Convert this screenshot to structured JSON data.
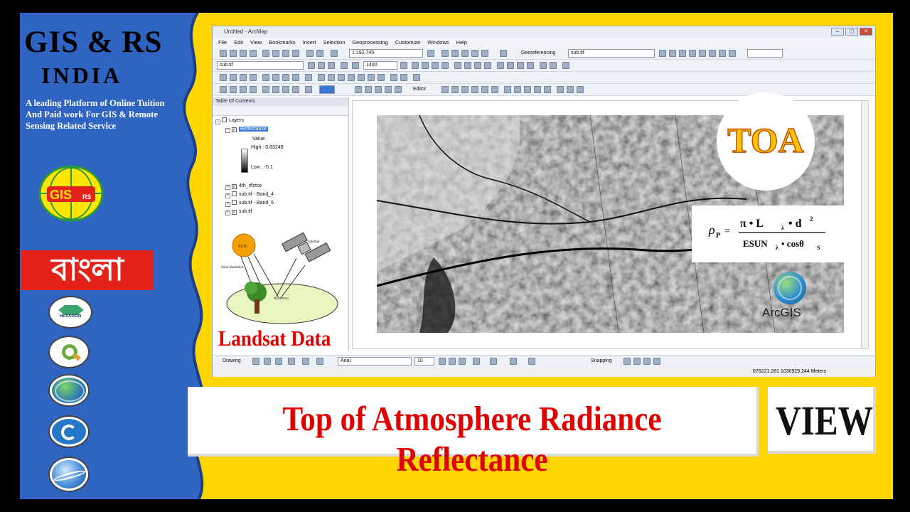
{
  "brand": {
    "title": "GIS & RS",
    "subtitle": "INDIA",
    "tagline": "A leading Platform of Online Tuition And Paid work For GIS & Remote Sensing Related Service",
    "logo_text": "GIS",
    "bangla": "বাংলা",
    "hexagon_label": "HEXAGON"
  },
  "arcmap": {
    "window_title": "Untitled - ArcMap",
    "menu": [
      "File",
      "Edit",
      "View",
      "Bookmarks",
      "Insert",
      "Selection",
      "Geoprocessing",
      "Customize",
      "Windows",
      "Help"
    ],
    "scale": "1:192,745",
    "georeferencing_label": "Georeferencing",
    "georef_layer": "sub.tif",
    "layer_dropdown": "sub.tif",
    "zoom_value": "1400",
    "editor_label": "Editor",
    "toc_title": "Table Of Contents",
    "toc": {
      "root": "Layers",
      "active_layer": "Reflectance",
      "value_label": "Value",
      "high": "High : 0.83248",
      "low": "Low : -0.1",
      "layers": [
        "4th_rflctce",
        "sub.tif - Band_4",
        "sub.tif - Band_5",
        "sub.tif"
      ],
      "layer_checked": [
        true,
        false,
        false,
        true
      ]
    },
    "drawing_label": "Drawing",
    "font_name": "Arial",
    "font_size": "10",
    "snapping_label": "Snapping",
    "coordinates": "676221.281  1030929.244 Meters"
  },
  "diagram": {
    "sun": "SUN",
    "satellite": "Satellite",
    "solar_radiation": "Solar Radiation",
    "reflection": "Reflection"
  },
  "landsat_label": "Landsat Data",
  "toa_label": "TOA",
  "formula": {
    "lhs": "ρ",
    "lhs_sub": "P",
    "numerator": "π • L",
    "numerator_sub": "λ",
    "numerator_tail": "• d",
    "numerator_sup": "2",
    "denominator": "ESUN",
    "denominator_sub": "λ",
    "denominator_tail": "• cosθ",
    "denominator_tail_sub": "S"
  },
  "arcgis_label": "ArcGIS",
  "banner_text": "Top of Atmosphere Radiance Reflectance",
  "view_text": "VIEW",
  "colors": {
    "yellow": "#FFD600",
    "blue": "#2F64C2",
    "red": "#E00000",
    "bangla_bg": "#E32219"
  }
}
